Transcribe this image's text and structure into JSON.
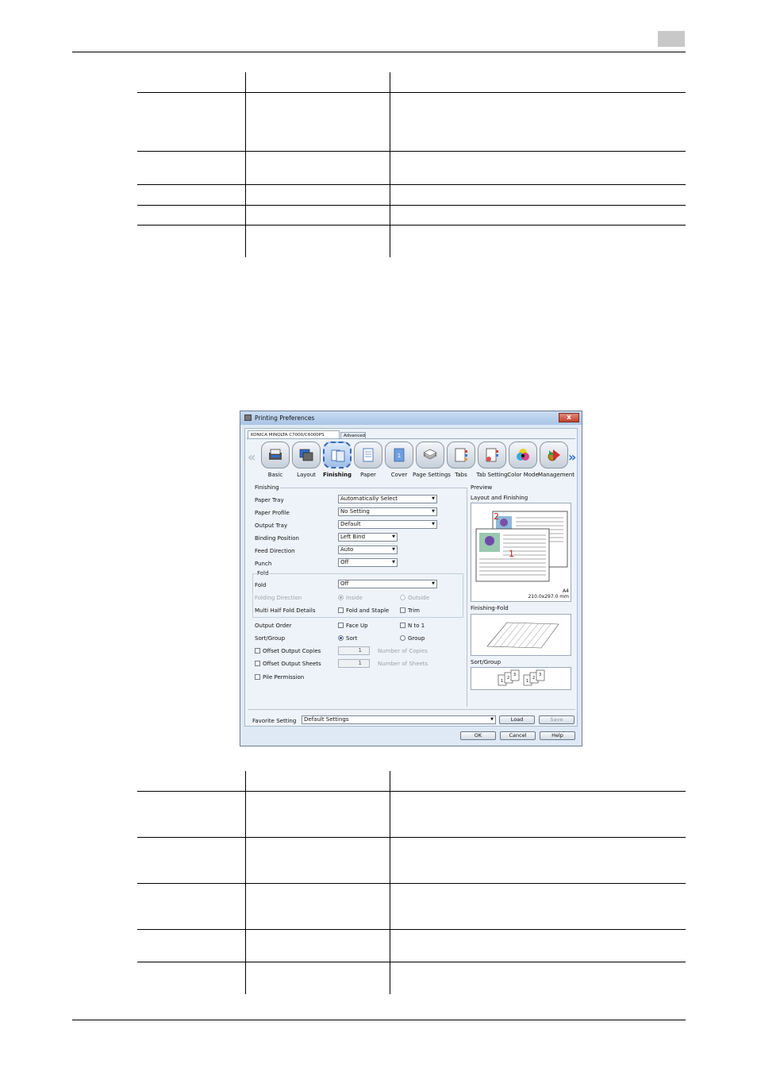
{
  "page": {
    "page_number_box": ""
  },
  "dialog": {
    "title": "Printing Preferences",
    "close_label": "x",
    "tabs": [
      "KONICA MINOLTA C7000/C6000PS",
      "Advanced"
    ],
    "toolbar": {
      "left_arrow": "«",
      "right_arrow": "»",
      "items": [
        "Basic",
        "Layout",
        "Finishing",
        "Paper",
        "Cover",
        "Page Settings",
        "Tabs",
        "Tab Setting",
        "Color Mode",
        "Management"
      ]
    },
    "finishing": {
      "group_label": "Finishing",
      "paper_tray_label": "Paper Tray",
      "paper_tray_value": "Automatically Select",
      "paper_profile_label": "Paper Profile",
      "paper_profile_value": "No Setting",
      "output_tray_label": "Output Tray",
      "output_tray_value": "Default",
      "binding_position_label": "Binding Position",
      "binding_position_value": "Left Bind",
      "feed_direction_label": "Feed Direction",
      "feed_direction_value": "Auto",
      "punch_label": "Punch",
      "punch_value": "Off",
      "fold_group_label": "Fold",
      "fold_label": "Fold",
      "fold_value": "Off",
      "folding_direction_label": "Folding Direction",
      "inside_label": "Inside",
      "outside_label": "Outside",
      "multi_half_fold_label": "Multi Half Fold Details",
      "fold_and_staple_label": "Fold and Staple",
      "trim_label": "Trim",
      "output_order_label": "Output Order",
      "face_up_label": "Face Up",
      "n_to_1_label": "N to 1",
      "sort_group_label": "Sort/Group",
      "sort_label": "Sort",
      "group_option_label": "Group",
      "offset_copies_label": "Offset Output Copies",
      "offset_copies_value": "1",
      "number_of_copies_label": "Number of Copies",
      "offset_sheets_label": "Offset Output Sheets",
      "offset_sheets_value": "1",
      "number_of_sheets_label": "Number of Sheets",
      "pile_permission_label": "Pile Permission"
    },
    "preview": {
      "group_label": "Preview",
      "layout_label": "Layout and Finishing",
      "page_num_back": "2",
      "page_num_front": "1",
      "paper_size": "A4",
      "paper_dims": "210.0x297.0 mm",
      "fold_label": "Finishing-Fold",
      "sort_label": "Sort/Group",
      "sort_pages": [
        "1",
        "2",
        "3",
        "1",
        "2",
        "3"
      ]
    },
    "favorite": {
      "label": "Favorite Setting",
      "value": "Default Settings",
      "load_label": "Load",
      "save_label": "Save"
    },
    "buttons": {
      "ok": "OK",
      "cancel": "Cancel",
      "help": "Help"
    }
  }
}
